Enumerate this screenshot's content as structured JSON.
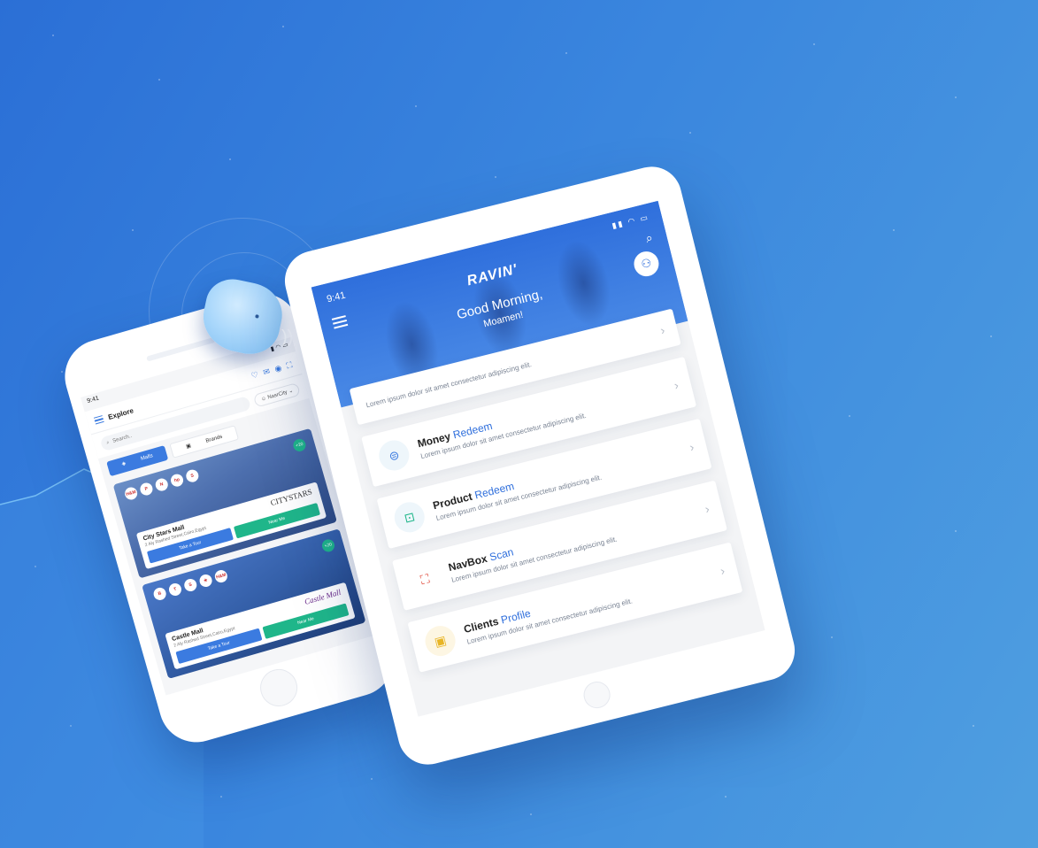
{
  "phone": {
    "status_time": "9:41",
    "screen_title": "Explore",
    "search_placeholder": "Search..",
    "city_selector": "NasrCity",
    "tabs": [
      {
        "label": "Malls"
      },
      {
        "label": "Brands"
      }
    ],
    "malls": [
      {
        "name": "City Stars Mall",
        "address": "2 Aly Rashed Street,Cairo,Egypt",
        "brand_text": "CITYSTARS",
        "more_badge": "+20",
        "tour_label": "Take a Tour",
        "near_label": "Near Me",
        "logos": [
          "H&M",
          "P",
          "N",
          "hp",
          "S"
        ]
      },
      {
        "name": "Castle Mall",
        "address": "2 Aly Rashed Street,Cairo,Egypt",
        "brand_text": "Castle Mall",
        "more_badge": "+20",
        "tour_label": "Take a Tour",
        "near_label": "Near Me",
        "logos": [
          "B",
          "T",
          "S",
          "★",
          "H&M"
        ]
      }
    ]
  },
  "tablet": {
    "status_time": "9:41",
    "brand_logo": "RAVIN'",
    "greeting": "Good Morning,",
    "user_name": "Moamen!",
    "items": [
      {
        "title_bold": "",
        "title_light": "",
        "desc": "Lorem ipsum dolor sit amet consectetur adipiscing elit.",
        "icon": "none"
      },
      {
        "title_bold": "Money",
        "title_light": "Redeem",
        "desc": "Lorem ipsum dolor sit amet consectetur adipiscing elit.",
        "icon": "coins-icon"
      },
      {
        "title_bold": "Product",
        "title_light": "Redeem",
        "desc": "Lorem ipsum dolor sit amet consectetur adipiscing elit.",
        "icon": "basket-icon"
      },
      {
        "title_bold": "NavBox",
        "title_light": "Scan",
        "desc": "Lorem ipsum dolor sit amet consectetur adipiscing elit.",
        "icon": "scan-icon"
      },
      {
        "title_bold": "Clients",
        "title_light": "Profile",
        "desc": "Lorem ipsum dolor sit amet consectetur adipiscing elit.",
        "icon": "profile-icon"
      }
    ]
  },
  "colors": {
    "background": "#3a86de",
    "accent_blue": "#3b7be0",
    "accent_green": "#1fb68a"
  }
}
